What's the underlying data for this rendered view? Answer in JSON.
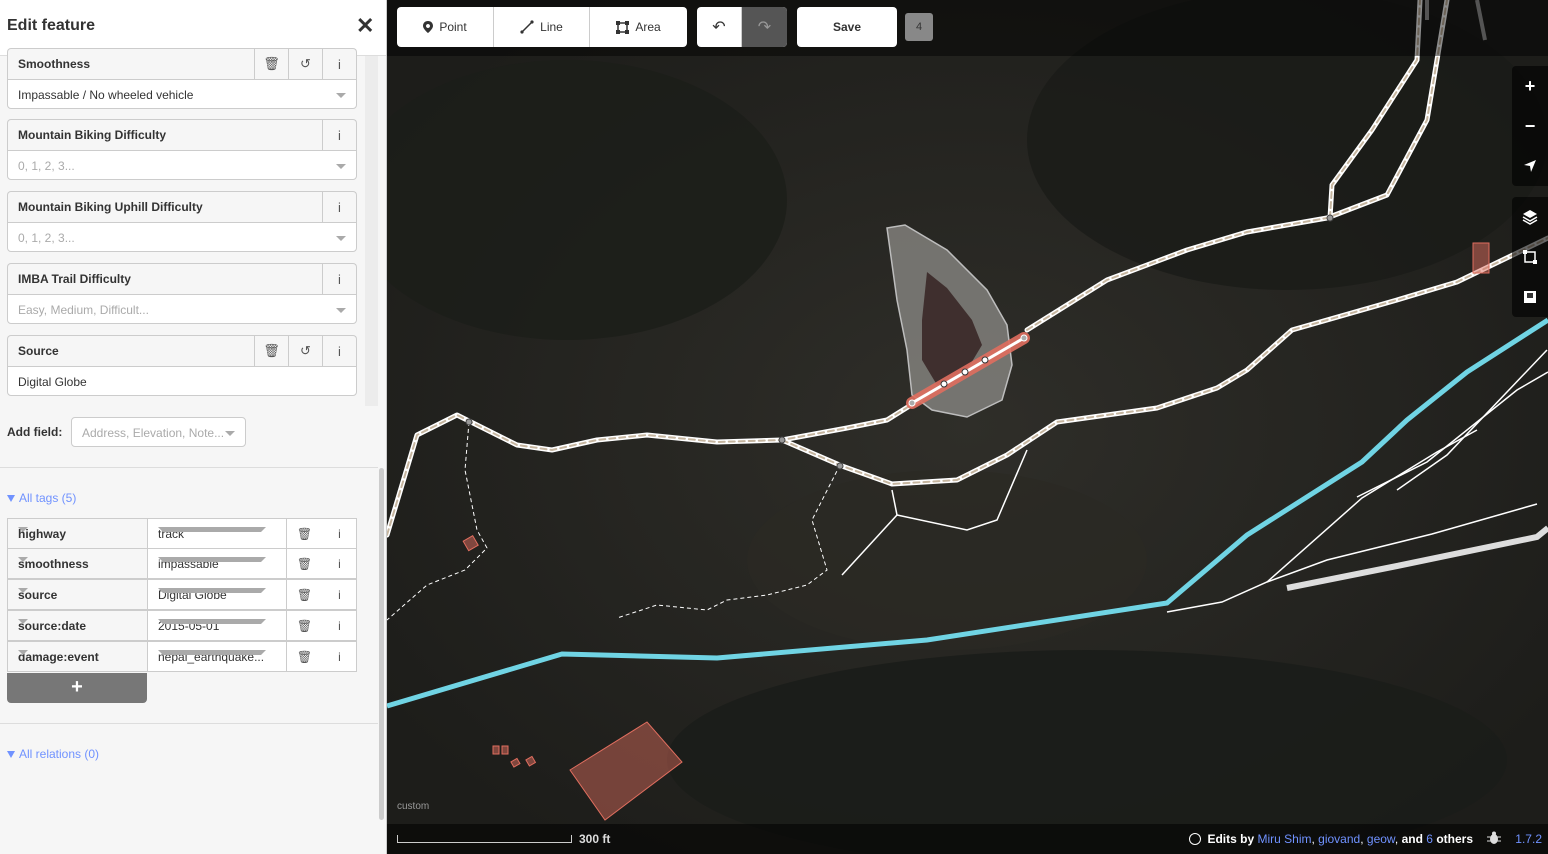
{
  "sidebar": {
    "title": "Edit feature",
    "close_icon": "close-icon",
    "fields": [
      {
        "label": "Smoothness",
        "value": "Impassable / No wheeled vehicle",
        "placeholder": ""
      },
      {
        "label": "Mountain Biking Difficulty",
        "value": "",
        "placeholder": "0, 1, 2, 3..."
      },
      {
        "label": "Mountain Biking Uphill Difficulty",
        "value": "",
        "placeholder": "0, 1, 2, 3..."
      },
      {
        "label": "IMBA Trail Difficulty",
        "value": "",
        "placeholder": "Easy, Medium, Difficult..."
      },
      {
        "label": "Source",
        "value": "Digital Globe",
        "placeholder": ""
      }
    ],
    "add_field": {
      "label": "Add field:",
      "placeholder": "Address, Elevation, Note..."
    },
    "all_tags": {
      "label": "All tags (5)"
    },
    "tags": [
      {
        "key": "highway",
        "value": "track"
      },
      {
        "key": "smoothness",
        "value": "impassable"
      },
      {
        "key": "source",
        "value": "Digital Globe"
      },
      {
        "key": "source:date",
        "value": "2015-05-01"
      },
      {
        "key": "damage:event",
        "value": "nepal_earthquake..."
      }
    ],
    "add_tag": "+",
    "all_relations": {
      "label": "All relations (0)"
    }
  },
  "toolbar": {
    "point": "Point",
    "line": "Line",
    "area": "Area",
    "save": "Save",
    "edit_count": "4"
  },
  "map": {
    "imagery_label": "custom",
    "scale": "300 ft",
    "attribution": {
      "prefix": "Edits by",
      "users": [
        "Miru Shim",
        "giovand",
        "geow"
      ],
      "and": "and",
      "others_count": "6",
      "others": "others"
    },
    "version": "1.7.2"
  },
  "colors": {
    "accent": "#7092ff",
    "stream": "#70d4e4",
    "selected": "#e06e5f",
    "track": "#c5b59f"
  }
}
